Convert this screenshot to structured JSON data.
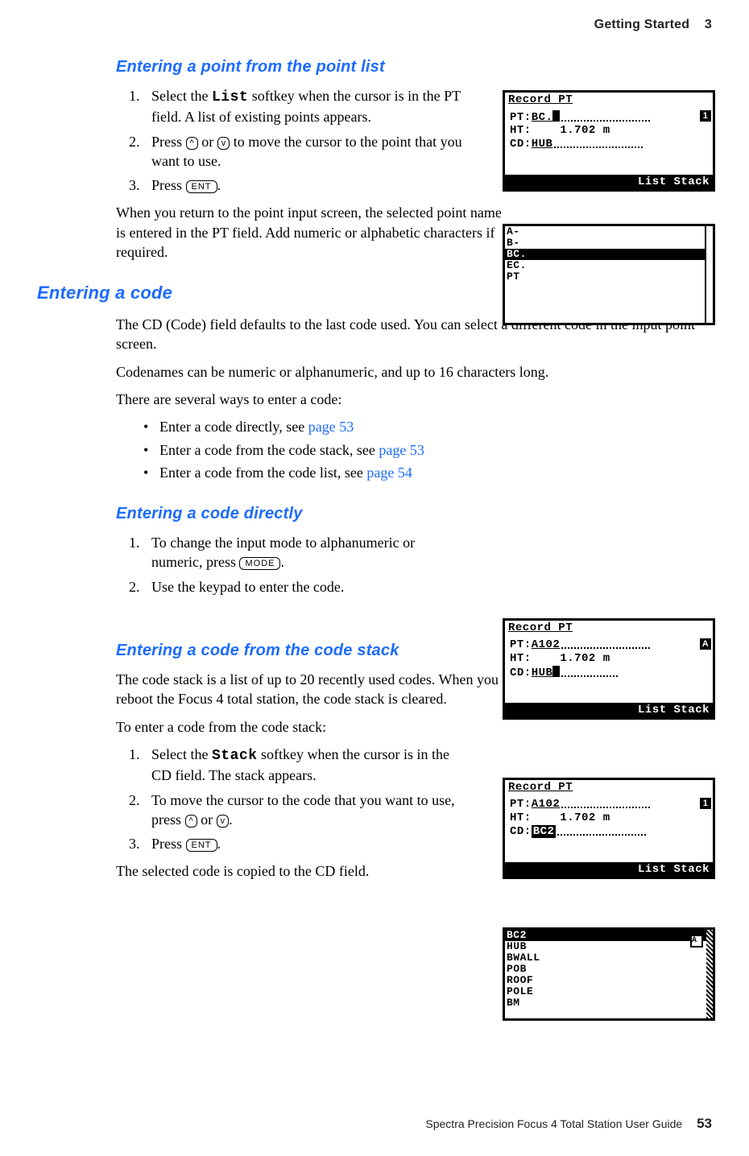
{
  "header": {
    "section": "Getting Started",
    "chapter_num": "3"
  },
  "h1": "Entering a point from the point list",
  "s1": {
    "step1a": "Select the ",
    "step1_soft": "List",
    "step1b": " softkey when the cursor is in the PT field. A list of existing points appears.",
    "step2a": "Press ",
    "step2b": " or ",
    "step2c": " to move the cursor to the point that you want to use.",
    "step3a": "Press ",
    "step3b": ".",
    "after": "When you return to the point input screen, the selected point name is entered in the PT field. Add numeric or alphabetic characters if required."
  },
  "keys": {
    "up": "^",
    "down": "v",
    "ent": "ENT",
    "mode": "MODE"
  },
  "screenA": {
    "title": "Record PT",
    "pt_label": "PT:",
    "pt_val": "BC.",
    "ht_label": "HT:",
    "ht_val": "1.702",
    "ht_unit": "m",
    "cd_label": "CD:",
    "cd_val": "HUB",
    "badge": "1",
    "footer": "List Stack"
  },
  "screenB": {
    "items": [
      "A-",
      "B-",
      "BC.",
      "EC.",
      "PT"
    ],
    "selected_index": 2
  },
  "h2": "Entering a code",
  "s2": {
    "p1": "The CD (Code) field defaults to the last code used. You can select a different code in the input point screen.",
    "p2": "Codenames can be numeric or alphanumeric, and up to 16 characters long.",
    "p3": "There are several ways to enter a code:",
    "b1a": "Enter a code directly, see ",
    "b1l": "page 53",
    "b2a": "Enter a code from the code stack, see ",
    "b2l": "page 53",
    "b3a": "Enter a code from the code list, see ",
    "b3l": "page 54"
  },
  "h3": "Entering a code directly",
  "s3": {
    "step1a": "To change the input mode to alphanumeric or numeric, press ",
    "step1b": ".",
    "step2": "Use the keypad to enter the code."
  },
  "screenC": {
    "title": "Record PT",
    "pt_label": "PT:",
    "pt_val": "A102",
    "ht_label": "HT:",
    "ht_val": "1.702",
    "ht_unit": "m",
    "cd_label": "CD:",
    "cd_val": "HUB",
    "badge": "A",
    "footer": "List Stack"
  },
  "h4": "Entering a code from the code stack",
  "s4": {
    "p1": "The code stack is a list of up to 20 recently used codes. When you reboot the Focus 4 total station, the code stack is cleared.",
    "p2": "To enter a code from the code stack:",
    "step1a": "Select the ",
    "step1_soft": "Stack",
    "step1b": " softkey when the cursor is in the CD field. The stack appears.",
    "step2a": "To move the cursor to the code that you want to use, press ",
    "step2b": " or ",
    "step2c": ".",
    "step3a": "Press ",
    "step3b": ".",
    "after": "The selected code is copied to the CD field."
  },
  "screenD": {
    "title": "Record PT",
    "pt_label": "PT:",
    "pt_val": "A102",
    "ht_label": "HT:",
    "ht_val": "1.702",
    "ht_unit": "m",
    "cd_label": "CD:",
    "cd_val": "BC2",
    "badge": "1",
    "footer": "List Stack"
  },
  "screenE": {
    "items": [
      "BC2",
      "HUB",
      "BWALL",
      "POB",
      "ROOF",
      "POLE",
      "BM"
    ],
    "selected_index": 0,
    "badge": "A"
  },
  "footer": {
    "book": "Spectra Precision Focus 4 Total Station User Guide",
    "page": "53"
  }
}
